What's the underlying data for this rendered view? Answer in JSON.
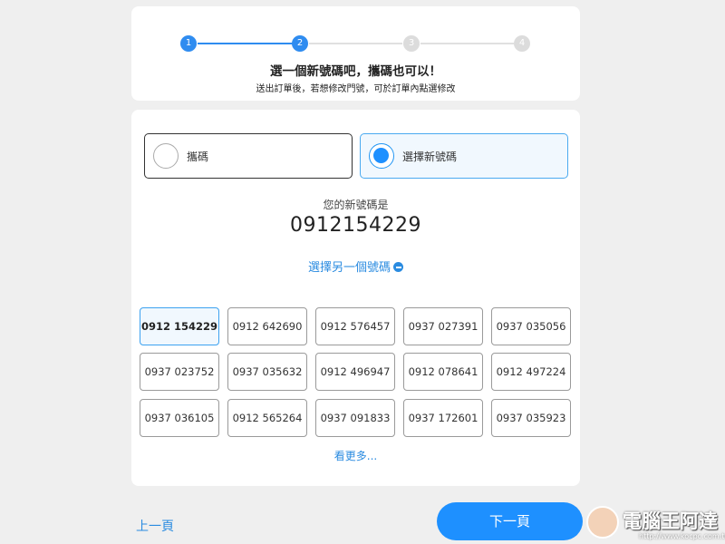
{
  "stepper": {
    "steps": [
      "1",
      "2",
      "3",
      "4"
    ],
    "current_step": 2,
    "title": "選一個新號碼吧，攜碼也可以！",
    "subtitle": "送出訂單後，若想修改門號，可於訂單內點選修改"
  },
  "options": {
    "port": "攜碼",
    "new_number": "選擇新號碼",
    "selected": "new_number"
  },
  "result": {
    "label": "您的新號碼是",
    "number": "0912154229"
  },
  "choose_another": "選擇另一個號碼",
  "numbers": [
    "0912 154229",
    "0912 642690",
    "0912 576457",
    "0937 027391",
    "0937 035056",
    "0937 023752",
    "0937 035632",
    "0912 496947",
    "0912 078641",
    "0912 497224",
    "0937 036105",
    "0912 565264",
    "0937 091833",
    "0937 172601",
    "0937 035923"
  ],
  "selected_number_index": 0,
  "see_more": "看更多...",
  "nav": {
    "prev": "上一頁",
    "next": "下一頁"
  },
  "watermark": {
    "text": "電腦王阿達",
    "url": "http://www.kocpc.com.tw"
  },
  "colors": {
    "accent": "#1e90ff",
    "selected_bg": "#f1f8fe",
    "inactive_step": "#dcdcdc"
  }
}
